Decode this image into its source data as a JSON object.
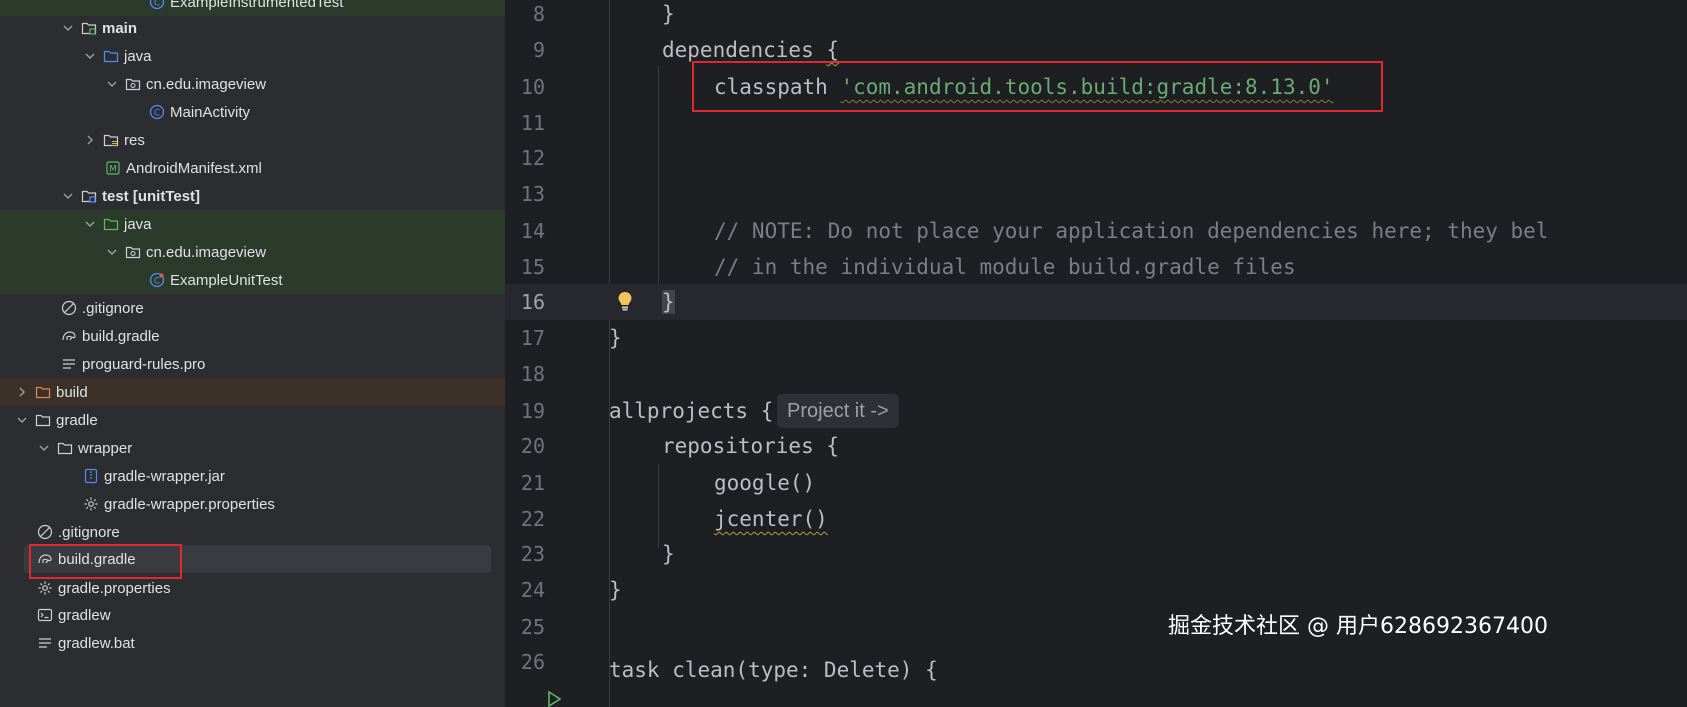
{
  "tree": {
    "items": [
      {
        "label": "ExampleInstrumentedTest"
      },
      {
        "label": "main"
      },
      {
        "label": "java"
      },
      {
        "label": "cn.edu.imageview"
      },
      {
        "label": "MainActivity"
      },
      {
        "label": "res"
      },
      {
        "label": "AndroidManifest.xml"
      },
      {
        "label": "test [unitTest]"
      },
      {
        "label": "java"
      },
      {
        "label": "cn.edu.imageview"
      },
      {
        "label": "ExampleUnitTest"
      },
      {
        "label": ".gitignore"
      },
      {
        "label": "build.gradle"
      },
      {
        "label": "proguard-rules.pro"
      },
      {
        "label": "build"
      },
      {
        "label": "gradle"
      },
      {
        "label": "wrapper"
      },
      {
        "label": "gradle-wrapper.jar"
      },
      {
        "label": "gradle-wrapper.properties"
      },
      {
        "label": ".gitignore"
      },
      {
        "label": "build.gradle"
      },
      {
        "label": "gradle.properties"
      },
      {
        "label": "gradlew"
      },
      {
        "label": "gradlew.bat"
      }
    ]
  },
  "editor": {
    "line_numbers": [
      "8",
      "9",
      "10",
      "11",
      "12",
      "13",
      "14",
      "15",
      "16",
      "17",
      "18",
      "19",
      "20",
      "21",
      "22",
      "23",
      "24",
      "25",
      "26"
    ],
    "lines": {
      "l8": "}",
      "l9_kw": "dependencies ",
      "l9_brace": "{",
      "l10_kw": "classpath ",
      "l10_str": "'com.android.tools.build:gradle:8.13.0'",
      "l14": "// NOTE: Do not place your application dependencies here; they bel",
      "l15": "// in the individual module build.gradle files",
      "l16": "}",
      "l17": "}",
      "l19_kw": "allprojects ",
      "l19_brace": "{",
      "l19_hint": "Project it ->",
      "l20": "repositories {",
      "l21": "google()",
      "l22": "jcenter()",
      "l23": "}",
      "l24": "}",
      "l26": "task clean(type: Delete) {"
    }
  },
  "watermark": "掘金技术社区 @ 用户628692367400",
  "colors": {
    "tree_bg": "#2b2d30",
    "editor_bg": "#1e1f22",
    "test_row_bg": "#2b3a2b",
    "build_row_bg": "#3b3128",
    "string": "#6aab73",
    "comment": "#7a7e85",
    "highlight_box": "#e0282e"
  }
}
